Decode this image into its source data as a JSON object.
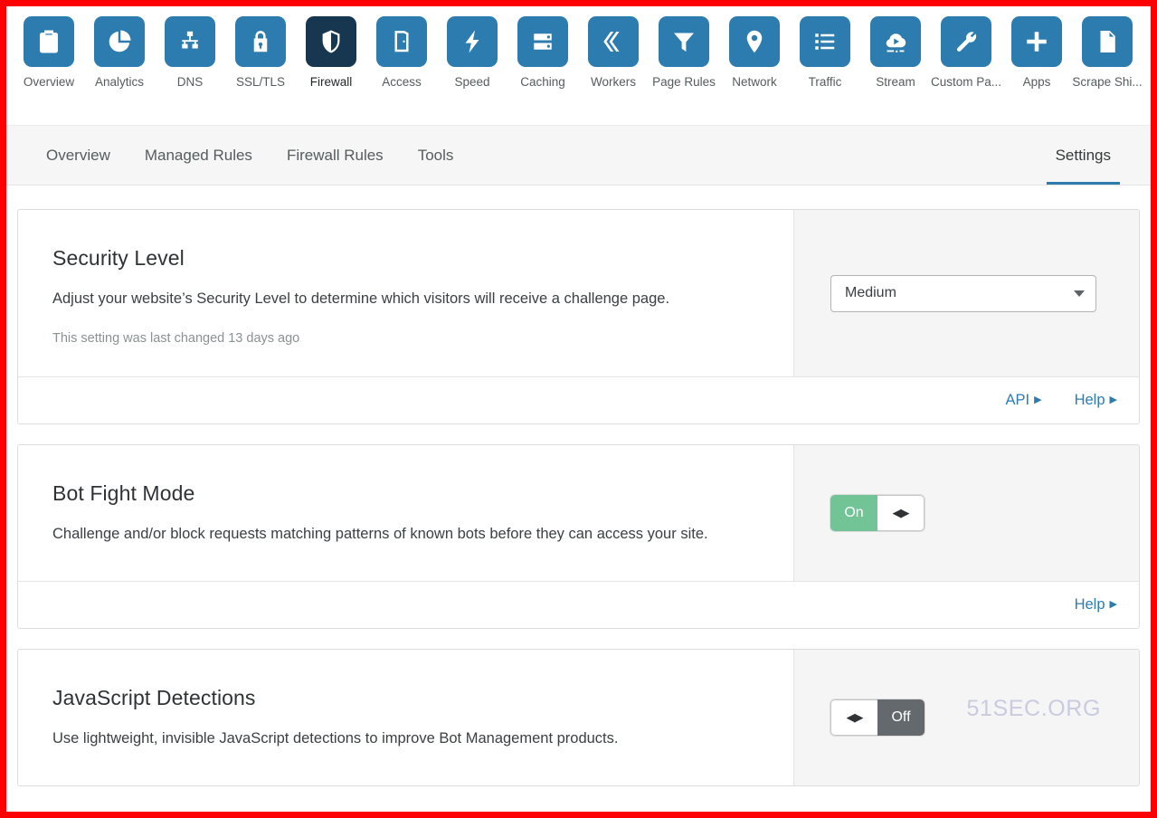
{
  "colors": {
    "frame": "#fe0000",
    "tile_blue": "#2d7cb0",
    "tile_active": "#17364f",
    "link_blue": "#2d7cb0",
    "toggle_on": "#72c496",
    "toggle_off": "#63696c",
    "panel_gray": "#f5f5f5",
    "watermark": "#c9cbe0"
  },
  "product_nav": {
    "items": [
      {
        "label": "Overview",
        "icon": "clipboard-icon",
        "active": false
      },
      {
        "label": "Analytics",
        "icon": "pie-chart-icon",
        "active": false
      },
      {
        "label": "DNS",
        "icon": "sitemap-icon",
        "active": false
      },
      {
        "label": "SSL/TLS",
        "icon": "lock-icon",
        "active": false
      },
      {
        "label": "Firewall",
        "icon": "shield-icon",
        "active": true
      },
      {
        "label": "Access",
        "icon": "door-icon",
        "active": false
      },
      {
        "label": "Speed",
        "icon": "lightning-icon",
        "active": false
      },
      {
        "label": "Caching",
        "icon": "server-icon",
        "active": false
      },
      {
        "label": "Workers",
        "icon": "chevrons-icon",
        "active": false
      },
      {
        "label": "Page Rules",
        "icon": "funnel-icon",
        "active": false
      },
      {
        "label": "Network",
        "icon": "map-pin-icon",
        "active": false
      },
      {
        "label": "Traffic",
        "icon": "list-icon",
        "active": false
      },
      {
        "label": "Stream",
        "icon": "cloud-play-icon",
        "active": false
      },
      {
        "label": "Custom Pa...",
        "icon": "wrench-icon",
        "active": false
      },
      {
        "label": "Apps",
        "icon": "plus-icon",
        "active": false
      },
      {
        "label": "Scrape Shi...",
        "icon": "document-icon",
        "active": false
      }
    ]
  },
  "subnav": {
    "left_tabs": [
      {
        "label": "Overview",
        "active": false
      },
      {
        "label": "Managed Rules",
        "active": false
      },
      {
        "label": "Firewall Rules",
        "active": false
      },
      {
        "label": "Tools",
        "active": false
      }
    ],
    "right_tabs": [
      {
        "label": "Settings",
        "active": true
      }
    ]
  },
  "settings": {
    "cards": [
      {
        "id": "security-level",
        "title": "Security Level",
        "description": "Adjust your website’s Security Level to determine which visitors will receive a challenge page.",
        "meta": "This setting was last changed 13 days ago",
        "control": {
          "type": "select",
          "value": "Medium"
        },
        "footer_links": [
          {
            "label": "API",
            "caret": "▶"
          },
          {
            "label": "Help",
            "caret": "▶"
          }
        ]
      },
      {
        "id": "bot-fight-mode",
        "title": "Bot Fight Mode",
        "description": "Challenge and/or block requests matching patterns of known bots before they can access your site.",
        "meta": "",
        "control": {
          "type": "toggle",
          "state": "on",
          "on_label": "On",
          "off_label": "Off",
          "knob_glyph": "◀▶"
        },
        "footer_links": [
          {
            "label": "Help",
            "caret": "▶"
          }
        ]
      },
      {
        "id": "javascript-detections",
        "title": "JavaScript Detections",
        "description": "Use lightweight, invisible JavaScript detections to improve Bot Management products.",
        "meta": "",
        "control": {
          "type": "toggle",
          "state": "off",
          "on_label": "On",
          "off_label": "Off",
          "knob_glyph": "◀▶"
        },
        "footer_links": []
      }
    ]
  },
  "watermark": {
    "text": "51SEC.ORG"
  }
}
